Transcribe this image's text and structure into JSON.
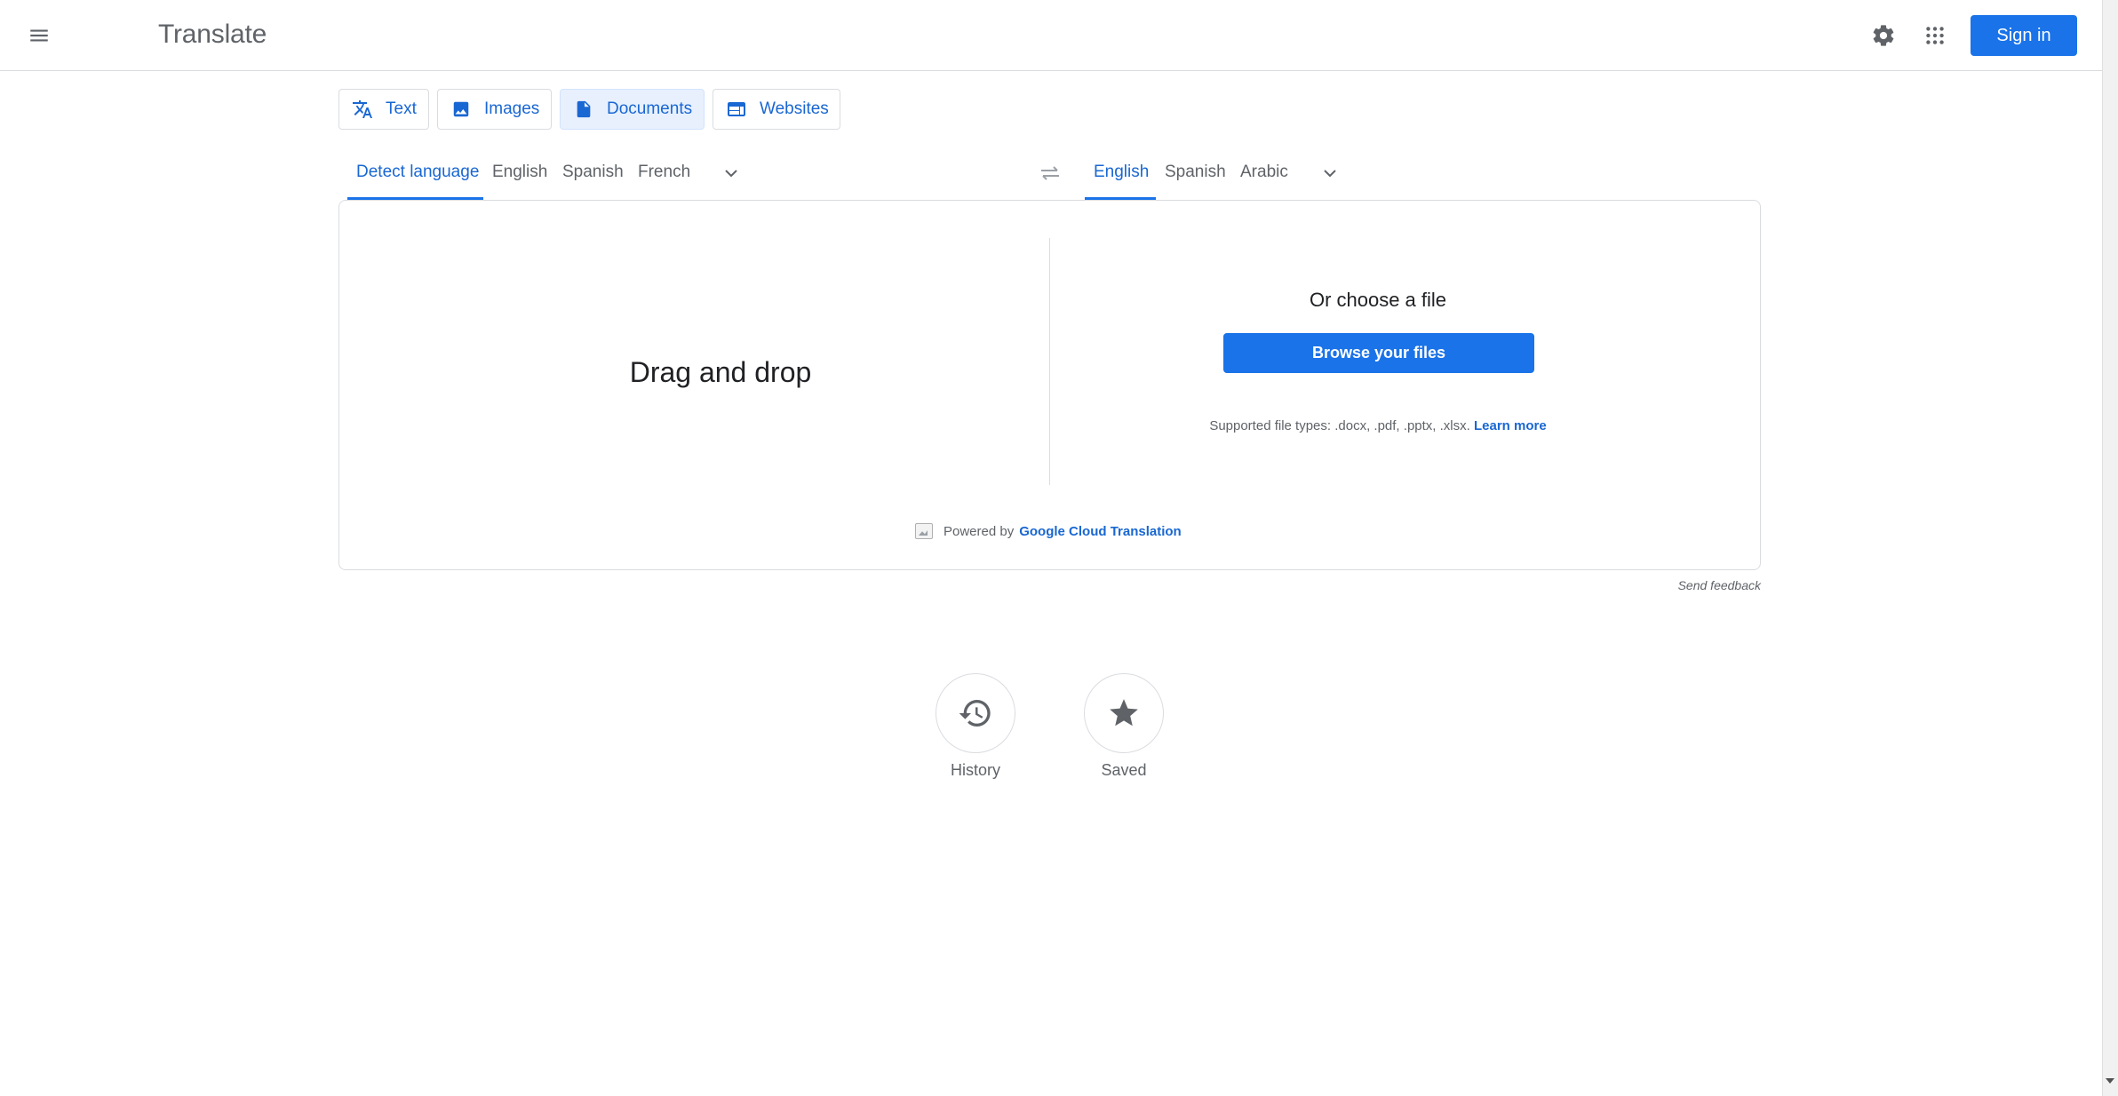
{
  "header": {
    "title": "Translate",
    "sign_in_label": "Sign in",
    "icons": [
      "menu-icon",
      "settings-icon",
      "apps-grid-icon"
    ]
  },
  "mode_tabs": [
    {
      "label": "Text",
      "icon": "translate-icon",
      "active": false
    },
    {
      "label": "Images",
      "icon": "image-icon",
      "active": false
    },
    {
      "label": "Documents",
      "icon": "document-icon",
      "active": true
    },
    {
      "label": "Websites",
      "icon": "web-icon",
      "active": false
    }
  ],
  "source_languages": {
    "items": [
      "Detect language",
      "English",
      "Spanish",
      "French"
    ],
    "selected": "Detect language"
  },
  "target_languages": {
    "items": [
      "English",
      "Spanish",
      "Arabic"
    ],
    "selected": "English"
  },
  "upload": {
    "drop_text": "Drag and drop",
    "choose_text": "Or choose a file",
    "browse_label": "Browse your files",
    "supported_text": "Supported file types: .docx, .pdf, .pptx, .xlsx.",
    "learn_more": "Learn more",
    "powered_by": "Powered by",
    "powered_link": "Google Cloud Translation"
  },
  "feedback_label": "Send feedback",
  "shortcuts": {
    "history_label": "History",
    "saved_label": "Saved"
  },
  "colors": {
    "accent": "#1a73e8",
    "link": "#1967d2",
    "border": "#dadce0",
    "muted_text": "#5f6368",
    "active_tab_bg": "#e8f0fe"
  }
}
